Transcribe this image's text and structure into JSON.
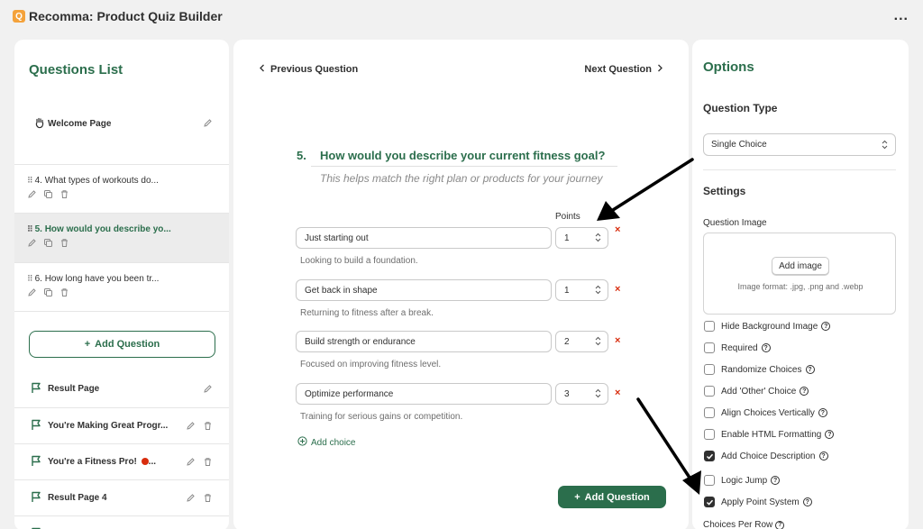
{
  "app": {
    "title": "Recomma: Product Quiz Builder",
    "icon": "recomma-logo-icon",
    "more": "..."
  },
  "left": {
    "title": "Questions List",
    "welcome": "Welcome Page",
    "questions": [
      {
        "label": "4. What types of workouts do..."
      },
      {
        "label": "5. How would you describe yo...",
        "selected": true
      },
      {
        "label": "6. How long have you been tr..."
      }
    ],
    "add_question": "Add Question",
    "results": [
      {
        "label": "Result Page"
      },
      {
        "label": "You're Making Great Progr..."
      },
      {
        "label": "You're a Fitness Pro! ",
        "dot": "..."
      },
      {
        "label": "Result Page 4"
      }
    ]
  },
  "center": {
    "prev": "Previous Question",
    "next": "Next Question",
    "number": "5.",
    "title": "How would you describe your current fitness goal?",
    "subtitle": "This helps match the right plan or products for your journey",
    "points_label": "Points",
    "choices": [
      {
        "label": "Just starting out",
        "points": "1",
        "description": "Looking to build a foundation."
      },
      {
        "label": "Get back in shape",
        "points": "1",
        "description": "Returning to fitness after a break."
      },
      {
        "label": "Build strength or endurance",
        "points": "2",
        "description": "Focused on improving fitness level."
      },
      {
        "label": "Optimize performance",
        "points": "3",
        "description": "Training for serious gains or competition."
      }
    ],
    "remove_glyph": "×",
    "add_choice": "Add choice",
    "add_question": "Add Question"
  },
  "options": {
    "title": "Options",
    "question_type_heading": "Question Type",
    "question_type_value": "Single Choice",
    "settings_heading": "Settings",
    "question_image_label": "Question Image",
    "add_image": "Add image",
    "image_format": "Image format: .jpg, .png and .webp",
    "checkboxes": [
      {
        "label": "Hide Background Image",
        "checked": false
      },
      {
        "label": "Required",
        "checked": false
      },
      {
        "label": "Randomize Choices",
        "checked": false
      },
      {
        "label": "Add 'Other' Choice",
        "checked": false
      },
      {
        "label": "Align Choices Vertically",
        "checked": false
      },
      {
        "label": "Enable HTML Formatting",
        "checked": false
      },
      {
        "label": "Add Choice Description",
        "checked": true
      },
      {
        "label": "Logic Jump",
        "checked": false
      },
      {
        "label": "Apply Point System",
        "checked": true
      }
    ],
    "choices_per_row": "Choices Per Row",
    "help_glyph": "?"
  },
  "colors": {
    "brand_green": "#2b6e4c",
    "remove_red": "#d82c0d",
    "accent_orange": "#f4a23b"
  }
}
